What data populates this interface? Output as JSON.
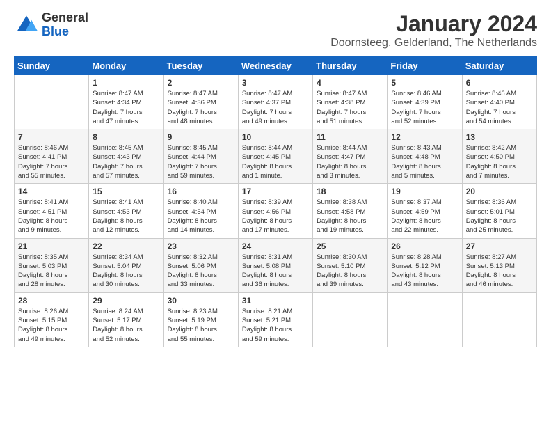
{
  "logo": {
    "general": "General",
    "blue": "Blue"
  },
  "header": {
    "month_year": "January 2024",
    "location": "Doornsteeg, Gelderland, The Netherlands"
  },
  "weekdays": [
    "Sunday",
    "Monday",
    "Tuesday",
    "Wednesday",
    "Thursday",
    "Friday",
    "Saturday"
  ],
  "weeks": [
    [
      {
        "day": "",
        "info": ""
      },
      {
        "day": "1",
        "info": "Sunrise: 8:47 AM\nSunset: 4:34 PM\nDaylight: 7 hours\nand 47 minutes."
      },
      {
        "day": "2",
        "info": "Sunrise: 8:47 AM\nSunset: 4:36 PM\nDaylight: 7 hours\nand 48 minutes."
      },
      {
        "day": "3",
        "info": "Sunrise: 8:47 AM\nSunset: 4:37 PM\nDaylight: 7 hours\nand 49 minutes."
      },
      {
        "day": "4",
        "info": "Sunrise: 8:47 AM\nSunset: 4:38 PM\nDaylight: 7 hours\nand 51 minutes."
      },
      {
        "day": "5",
        "info": "Sunrise: 8:46 AM\nSunset: 4:39 PM\nDaylight: 7 hours\nand 52 minutes."
      },
      {
        "day": "6",
        "info": "Sunrise: 8:46 AM\nSunset: 4:40 PM\nDaylight: 7 hours\nand 54 minutes."
      }
    ],
    [
      {
        "day": "7",
        "info": "Sunrise: 8:46 AM\nSunset: 4:41 PM\nDaylight: 7 hours\nand 55 minutes."
      },
      {
        "day": "8",
        "info": "Sunrise: 8:45 AM\nSunset: 4:43 PM\nDaylight: 7 hours\nand 57 minutes."
      },
      {
        "day": "9",
        "info": "Sunrise: 8:45 AM\nSunset: 4:44 PM\nDaylight: 7 hours\nand 59 minutes."
      },
      {
        "day": "10",
        "info": "Sunrise: 8:44 AM\nSunset: 4:45 PM\nDaylight: 8 hours\nand 1 minute."
      },
      {
        "day": "11",
        "info": "Sunrise: 8:44 AM\nSunset: 4:47 PM\nDaylight: 8 hours\nand 3 minutes."
      },
      {
        "day": "12",
        "info": "Sunrise: 8:43 AM\nSunset: 4:48 PM\nDaylight: 8 hours\nand 5 minutes."
      },
      {
        "day": "13",
        "info": "Sunrise: 8:42 AM\nSunset: 4:50 PM\nDaylight: 8 hours\nand 7 minutes."
      }
    ],
    [
      {
        "day": "14",
        "info": "Sunrise: 8:41 AM\nSunset: 4:51 PM\nDaylight: 8 hours\nand 9 minutes."
      },
      {
        "day": "15",
        "info": "Sunrise: 8:41 AM\nSunset: 4:53 PM\nDaylight: 8 hours\nand 12 minutes."
      },
      {
        "day": "16",
        "info": "Sunrise: 8:40 AM\nSunset: 4:54 PM\nDaylight: 8 hours\nand 14 minutes."
      },
      {
        "day": "17",
        "info": "Sunrise: 8:39 AM\nSunset: 4:56 PM\nDaylight: 8 hours\nand 17 minutes."
      },
      {
        "day": "18",
        "info": "Sunrise: 8:38 AM\nSunset: 4:58 PM\nDaylight: 8 hours\nand 19 minutes."
      },
      {
        "day": "19",
        "info": "Sunrise: 8:37 AM\nSunset: 4:59 PM\nDaylight: 8 hours\nand 22 minutes."
      },
      {
        "day": "20",
        "info": "Sunrise: 8:36 AM\nSunset: 5:01 PM\nDaylight: 8 hours\nand 25 minutes."
      }
    ],
    [
      {
        "day": "21",
        "info": "Sunrise: 8:35 AM\nSunset: 5:03 PM\nDaylight: 8 hours\nand 28 minutes."
      },
      {
        "day": "22",
        "info": "Sunrise: 8:34 AM\nSunset: 5:04 PM\nDaylight: 8 hours\nand 30 minutes."
      },
      {
        "day": "23",
        "info": "Sunrise: 8:32 AM\nSunset: 5:06 PM\nDaylight: 8 hours\nand 33 minutes."
      },
      {
        "day": "24",
        "info": "Sunrise: 8:31 AM\nSunset: 5:08 PM\nDaylight: 8 hours\nand 36 minutes."
      },
      {
        "day": "25",
        "info": "Sunrise: 8:30 AM\nSunset: 5:10 PM\nDaylight: 8 hours\nand 39 minutes."
      },
      {
        "day": "26",
        "info": "Sunrise: 8:28 AM\nSunset: 5:12 PM\nDaylight: 8 hours\nand 43 minutes."
      },
      {
        "day": "27",
        "info": "Sunrise: 8:27 AM\nSunset: 5:13 PM\nDaylight: 8 hours\nand 46 minutes."
      }
    ],
    [
      {
        "day": "28",
        "info": "Sunrise: 8:26 AM\nSunset: 5:15 PM\nDaylight: 8 hours\nand 49 minutes."
      },
      {
        "day": "29",
        "info": "Sunrise: 8:24 AM\nSunset: 5:17 PM\nDaylight: 8 hours\nand 52 minutes."
      },
      {
        "day": "30",
        "info": "Sunrise: 8:23 AM\nSunset: 5:19 PM\nDaylight: 8 hours\nand 55 minutes."
      },
      {
        "day": "31",
        "info": "Sunrise: 8:21 AM\nSunset: 5:21 PM\nDaylight: 8 hours\nand 59 minutes."
      },
      {
        "day": "",
        "info": ""
      },
      {
        "day": "",
        "info": ""
      },
      {
        "day": "",
        "info": ""
      }
    ]
  ]
}
